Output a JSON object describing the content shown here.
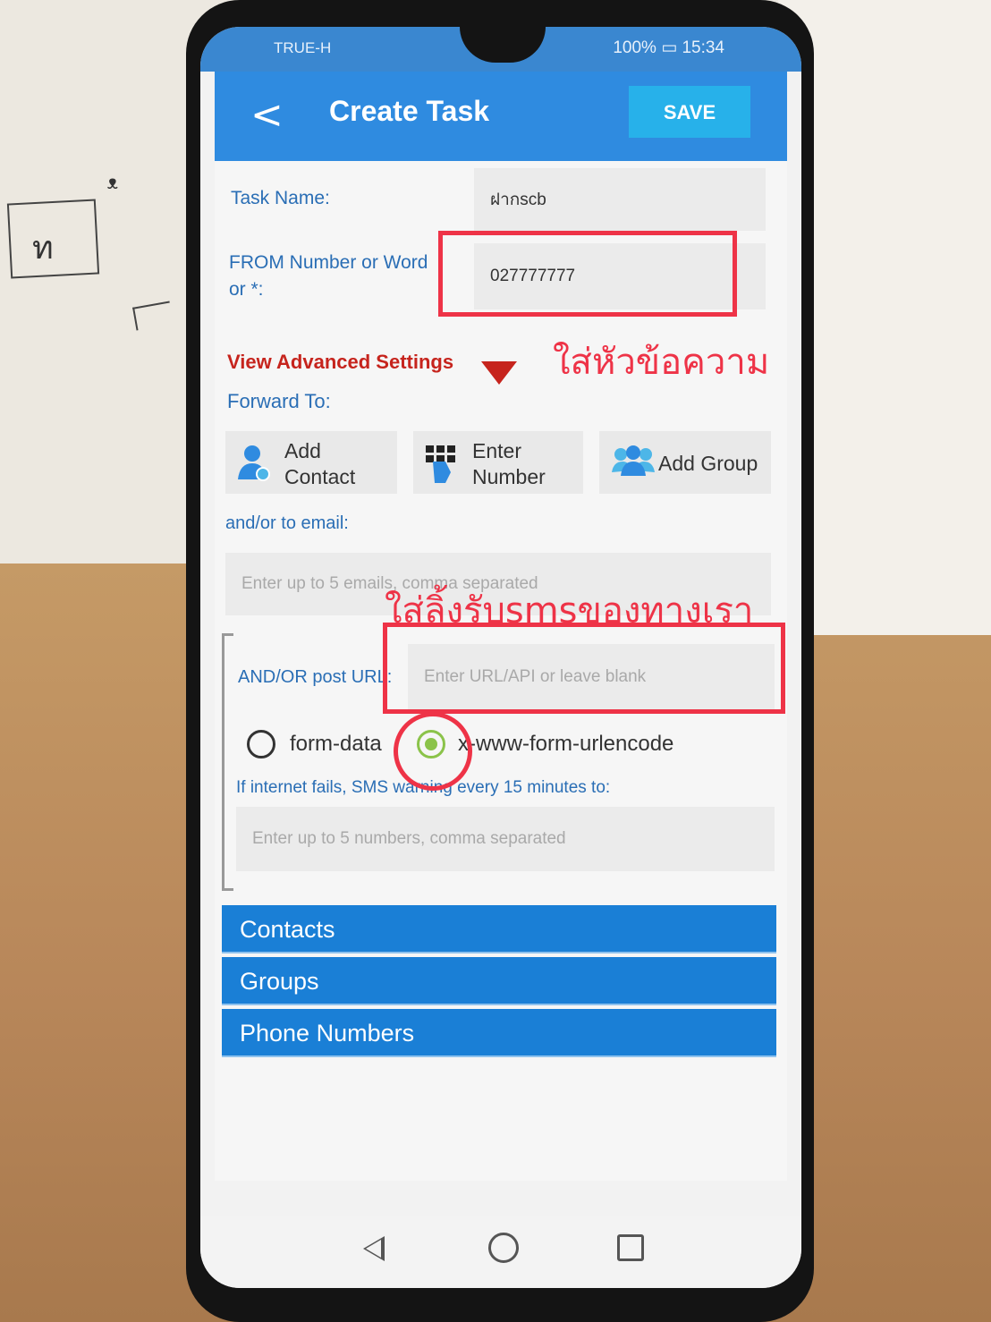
{
  "status_bar": {
    "carrier": "TRUE-H",
    "battery": "100%",
    "time": "15:34"
  },
  "header": {
    "back_label": "<",
    "title": "Create Task",
    "save_label": "SAVE"
  },
  "form": {
    "task_name_label": "Task Name:",
    "task_name_value": "ฝากscb",
    "from_label_line1": "FROM Number or Word",
    "from_label_line2": "or *:",
    "from_value": "027777777",
    "advanced_settings_label": "View Advanced Settings",
    "forward_to_label": "Forward To:",
    "forward_buttons": [
      {
        "line1": "Add",
        "line2": "Contact",
        "icon": "add-contact-icon"
      },
      {
        "line1": "Enter",
        "line2": "Number",
        "icon": "keypad-icon"
      },
      {
        "line1": "Add Group",
        "line2": "",
        "icon": "group-icon"
      }
    ],
    "email_label": "and/or to email:",
    "email_placeholder": "Enter up to 5 emails, comma separated",
    "post_url_label": "AND/OR post URL:",
    "post_url_placeholder": "Enter URL/API or leave blank",
    "encoding_options": [
      {
        "label": "form-data",
        "selected": false
      },
      {
        "label": "x-www-form-urlencode",
        "selected": true
      }
    ],
    "sms_warning_label": "If internet fails, SMS warning every 15 minutes to:",
    "sms_warning_placeholder": "Enter up to 5 numbers, comma separated"
  },
  "sections": [
    {
      "label": "Contacts"
    },
    {
      "label": "Groups"
    },
    {
      "label": "Phone Numbers"
    }
  ],
  "annotations": {
    "header_hint": "ใส่หัวข้อความ",
    "link_hint": "ใส่ลิ้งรับsmsของทางเรา"
  },
  "background_note": {
    "letter": "ท",
    "mark": "ᵜ"
  },
  "colors": {
    "appbar": "#2f8be0",
    "save_button": "#27b1ea",
    "label_blue": "#2a6eb5",
    "advanced_red": "#c6241d",
    "radio_selected": "#8bc34a",
    "section_blue": "#1a7fd6",
    "annotation_red": "#ee3347"
  }
}
